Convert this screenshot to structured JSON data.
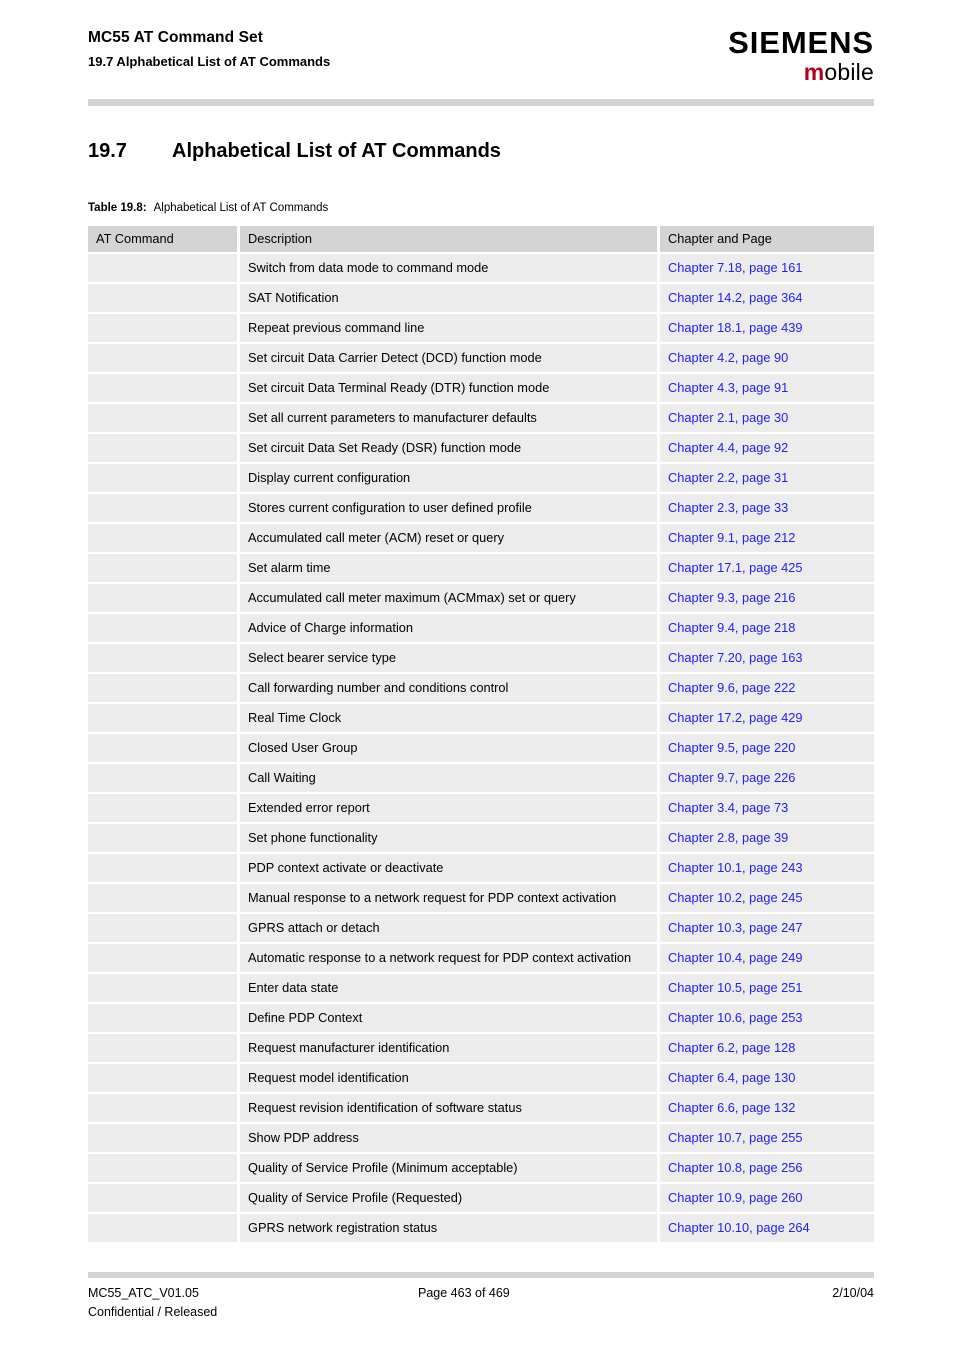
{
  "header": {
    "doc_title": "MC55 AT Command Set",
    "doc_subtitle": "19.7 Alphabetical List of AT Commands",
    "logo_brand": "SIEMENS",
    "logo_sub_first": "m",
    "logo_sub_rest": "obile",
    "brand_accent_color": "#b3001b"
  },
  "section": {
    "number": "19.7",
    "title": "Alphabetical List of AT Commands"
  },
  "table_caption": {
    "label": "Table 19.8:",
    "text": "Alphabetical List of AT Commands"
  },
  "table": {
    "columns": [
      "AT Command",
      "Description",
      "Chapter and Page"
    ],
    "link_color": "#2222ee",
    "rows": [
      {
        "command": "",
        "description": "Switch from data mode to command mode",
        "page_ref": "Chapter 7.18, page 161"
      },
      {
        "command": "",
        "description": "SAT Notification",
        "page_ref": "Chapter 14.2, page 364"
      },
      {
        "command": "",
        "description": "Repeat previous command line",
        "page_ref": "Chapter 18.1, page 439"
      },
      {
        "command": "",
        "description": "Set circuit Data Carrier Detect (DCD) function mode",
        "page_ref": "Chapter 4.2, page 90"
      },
      {
        "command": "",
        "description": "Set circuit Data Terminal Ready (DTR) function mode",
        "page_ref": "Chapter 4.3, page 91"
      },
      {
        "command": "",
        "description": "Set all current parameters to manufacturer defaults",
        "page_ref": "Chapter 2.1, page 30"
      },
      {
        "command": "",
        "description": "Set circuit Data Set Ready (DSR) function mode",
        "page_ref": "Chapter 4.4, page 92"
      },
      {
        "command": "",
        "description": "Display current configuration",
        "page_ref": "Chapter 2.2, page 31"
      },
      {
        "command": "",
        "description": "Stores current configuration to user defined profile",
        "page_ref": "Chapter 2.3, page 33"
      },
      {
        "command": "",
        "description": "Accumulated call meter (ACM) reset or query",
        "page_ref": "Chapter 9.1, page 212"
      },
      {
        "command": "",
        "description": "Set alarm time",
        "page_ref": "Chapter 17.1, page 425"
      },
      {
        "command": "",
        "description": "Accumulated call meter maximum (ACMmax) set or query",
        "page_ref": "Chapter 9.3, page 216"
      },
      {
        "command": "",
        "description": "Advice of Charge information",
        "page_ref": "Chapter 9.4, page 218"
      },
      {
        "command": "",
        "description": "Select bearer service type",
        "page_ref": "Chapter 7.20, page 163"
      },
      {
        "command": "",
        "description": "Call forwarding number and conditions control",
        "page_ref": "Chapter 9.6, page 222"
      },
      {
        "command": "",
        "description": "Real Time Clock",
        "page_ref": "Chapter 17.2, page 429"
      },
      {
        "command": "",
        "description": "Closed User Group",
        "page_ref": "Chapter 9.5, page 220"
      },
      {
        "command": "",
        "description": "Call Waiting",
        "page_ref": "Chapter 9.7, page 226"
      },
      {
        "command": "",
        "description": "Extended error report",
        "page_ref": "Chapter 3.4, page 73"
      },
      {
        "command": "",
        "description": "Set phone functionality",
        "page_ref": "Chapter 2.8, page 39"
      },
      {
        "command": "",
        "description": "PDP context activate or deactivate",
        "page_ref": "Chapter 10.1, page 243"
      },
      {
        "command": "",
        "description": "Manual response to a network request for PDP context activation",
        "page_ref": "Chapter 10.2, page 245"
      },
      {
        "command": "",
        "description": "GPRS attach or detach",
        "page_ref": "Chapter 10.3, page 247"
      },
      {
        "command": "",
        "description": "Automatic response to a network request for PDP context activation",
        "page_ref": "Chapter 10.4, page 249"
      },
      {
        "command": "",
        "description": "Enter data state",
        "page_ref": "Chapter 10.5, page 251"
      },
      {
        "command": "",
        "description": "Define PDP Context",
        "page_ref": "Chapter 10.6, page 253"
      },
      {
        "command": "",
        "description": "Request manufacturer identification",
        "page_ref": "Chapter 6.2, page 128"
      },
      {
        "command": "",
        "description": "Request model identification",
        "page_ref": "Chapter 6.4, page 130"
      },
      {
        "command": "",
        "description": "Request revision identification of software status",
        "page_ref": "Chapter 6.6, page 132"
      },
      {
        "command": "",
        "description": "Show PDP address",
        "page_ref": "Chapter 10.7, page 255"
      },
      {
        "command": "",
        "description": "Quality of Service Profile (Minimum acceptable)",
        "page_ref": "Chapter 10.8, page 256"
      },
      {
        "command": "",
        "description": "Quality of Service Profile (Requested)",
        "page_ref": "Chapter 10.9, page 260"
      },
      {
        "command": "",
        "description": "GPRS network registration status",
        "page_ref": "Chapter 10.10, page 264"
      }
    ]
  },
  "footer": {
    "doc_id": "MC55_ATC_V01.05",
    "page_number": "Page 463 of 469",
    "date": "2/10/04",
    "classification": "Confidential / Released"
  }
}
